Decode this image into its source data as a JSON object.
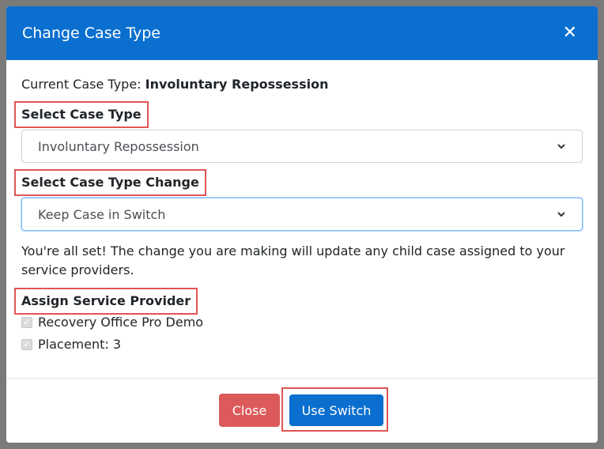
{
  "modal": {
    "title": "Change Case Type",
    "close_icon": "close-icon",
    "current_case_type_label": "Current Case Type:",
    "current_case_type_value": "Involuntary Repossession",
    "select_case_type_label": "Select Case Type",
    "select_case_type_value": "Involuntary Repossession",
    "select_case_type_change_label": "Select Case Type Change",
    "select_case_type_change_value": "Keep Case in Switch",
    "info_message": "You're all set! The change you are making will update any child case assigned to your service providers.",
    "assign_service_provider_label": "Assign Service Provider",
    "service_providers": [
      {
        "label": "Recovery Office Pro Demo",
        "checked": true
      },
      {
        "label": "Placement: 3",
        "checked": true
      }
    ],
    "buttons": {
      "close": "Close",
      "use_switch": "Use Switch"
    }
  },
  "colors": {
    "header": "#0b6fcf",
    "primary_button": "#0b6fcf",
    "danger_button": "#dc5a5a",
    "highlight_box": "#e05555"
  }
}
